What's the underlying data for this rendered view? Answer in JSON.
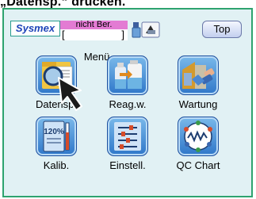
{
  "header": {
    "title": "„Datensp.“ drücken."
  },
  "topbar": {
    "brand": "Sysmex",
    "status": "nicht Ber.",
    "menu_label": "Menü",
    "bracket_open": "[",
    "bracket_close": "]",
    "top_button": "Top"
  },
  "menu": {
    "items": [
      {
        "label": "Datensp.",
        "icon": "folder-magnifier-icon"
      },
      {
        "label": "Reag.w.",
        "icon": "reagent-bottles-icon"
      },
      {
        "label": "Wartung",
        "icon": "maintenance-icon"
      },
      {
        "label": "Kalib.",
        "icon": "calibration-icon"
      },
      {
        "label": "Einstell.",
        "icon": "settings-sliders-icon"
      },
      {
        "label": "QC Chart",
        "icon": "qc-chart-icon"
      }
    ]
  },
  "colors": {
    "panel_border": "#2ea36f",
    "panel_bg": "#e1f1f4",
    "status_bg": "#e37bd3",
    "tile_blue": "#2f77c9"
  }
}
